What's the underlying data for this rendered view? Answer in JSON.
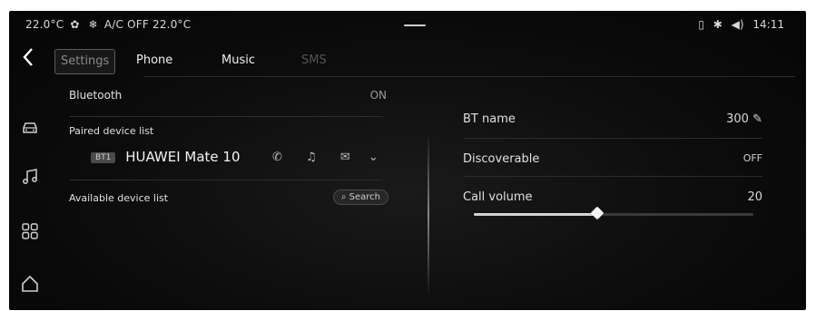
{
  "status": {
    "temp_left": "22.0°C",
    "ac_text": "A/C OFF",
    "temp_right": "22.0°C",
    "time": "14:11"
  },
  "tabs": [
    {
      "label": "Settings",
      "state": "active"
    },
    {
      "label": "Phone",
      "state": "normal"
    },
    {
      "label": "Music",
      "state": "normal"
    },
    {
      "label": "SMS",
      "state": "disabled"
    }
  ],
  "left": {
    "bluetooth_label": "Bluetooth",
    "bluetooth_value": "ON",
    "paired_label": "Paired device list",
    "device": {
      "badge": "BT1",
      "name": "HUAWEI Mate 10"
    },
    "available_label": "Available device list",
    "search_label": "Search"
  },
  "right": {
    "bt_name_label": "BT name",
    "bt_name_value": "300",
    "discoverable_label": "Discoverable",
    "discoverable_value": "OFF",
    "call_volume_label": "Call volume",
    "call_volume_value": "20",
    "call_volume_fraction": 0.44
  },
  "icons": {
    "back": "chevron-left-icon",
    "car": "car-icon",
    "music": "music-note-icon",
    "apps": "grid-icon",
    "home": "home-icon"
  },
  "colors": {
    "background": "#0c0c0c",
    "text": "#e8e8e8",
    "muted": "#9a9a9a",
    "slider_fill": "#d4d4d4"
  }
}
